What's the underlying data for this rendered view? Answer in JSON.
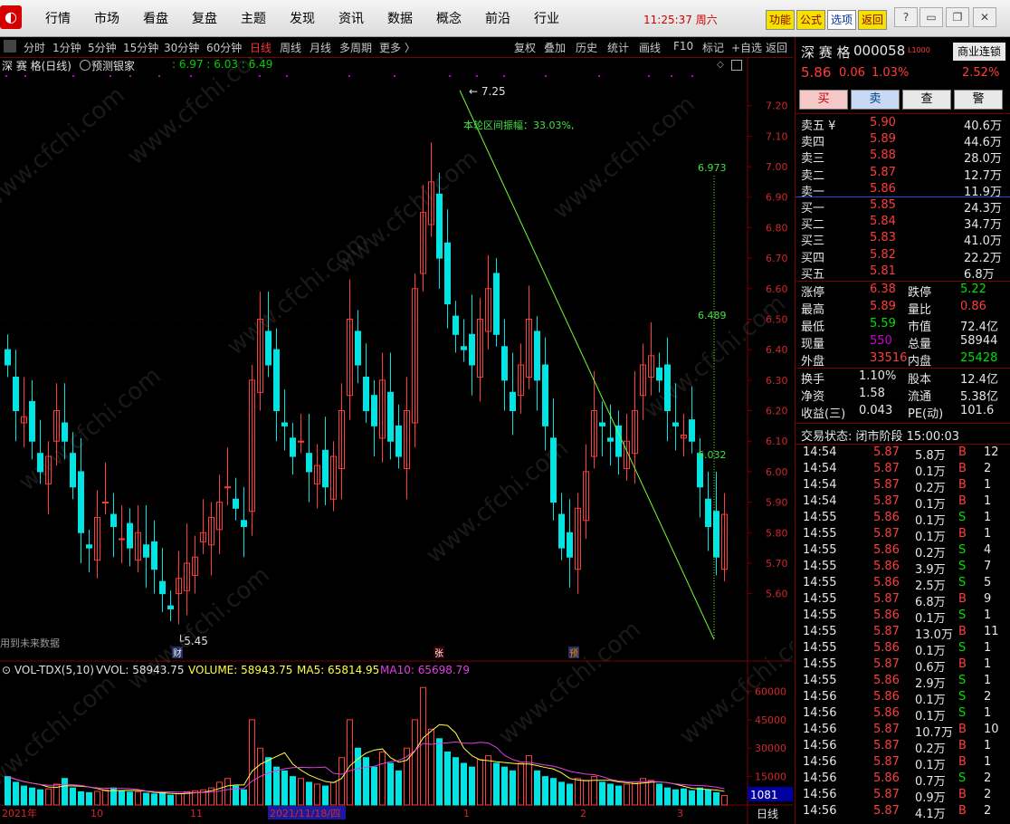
{
  "menu": {
    "items": [
      "行情",
      "市场",
      "看盘",
      "复盘",
      "主题",
      "发现",
      "资讯",
      "数据",
      "概念",
      "前沿",
      "行业"
    ],
    "clock": "11:25:37 周六",
    "fn_buttons": [
      "功能",
      "公式",
      "选项",
      "返回"
    ]
  },
  "toolbar": {
    "periods": [
      "分时",
      "1分钟",
      "5分钟",
      "15分钟",
      "30分钟",
      "60分钟",
      "日线",
      "周线",
      "月线",
      "多周期",
      "更多 〉"
    ],
    "active_period": "日线",
    "actions": [
      "复权",
      "叠加",
      "历史",
      "统计",
      "画线",
      "F10",
      "标记",
      "+自选",
      "返回"
    ]
  },
  "chart": {
    "title": "深 赛 格(日线)",
    "forecast_label": "预测银家",
    "ma_values": ": 6.97 : 6.03 : 6.49",
    "high_label": "7.25",
    "low_label": "5.45",
    "range_text": "本轮区间振幅：33.03%,",
    "fib_labels": [
      "6.973",
      "6.489",
      "6.032"
    ],
    "future_note": "用到未来数据",
    "event_markers": [
      "财",
      "张",
      "预"
    ],
    "price_ticks": [
      "7.20",
      "7.10",
      "7.00",
      "6.90",
      "6.80",
      "6.70",
      "6.60",
      "6.50",
      "6.40",
      "6.30",
      "6.20",
      "6.10",
      "6.00",
      "5.90",
      "5.80",
      "5.70",
      "5.60"
    ],
    "vol_header": {
      "name": "VOL-TDX(5,10)",
      "vvol": "VVOL: 58943.75",
      "volume": "VOLUME: 58943.75",
      "ma5": "MA5: 65814.95",
      "ma10": "MA10: 65698.79"
    },
    "vol_ticks": [
      "60000",
      "45000",
      "30000",
      "15000"
    ],
    "vol_current": "1081",
    "date_ticks": [
      "2021年",
      "10",
      "11",
      "2021/11/18/四",
      "1",
      "2",
      "3"
    ],
    "footer_tab": "日线",
    "watermark": "www.cfchi.com"
  },
  "chart_data": {
    "type": "candlestick",
    "ylim": [
      5.4,
      7.3
    ],
    "closes": [
      6.35,
      6.2,
      6.18,
      6.1,
      6.0,
      6.05,
      6.2,
      6.1,
      5.95,
      5.8,
      5.75,
      5.85,
      5.9,
      5.82,
      5.78,
      5.75,
      5.8,
      5.72,
      5.68,
      5.6,
      5.55,
      5.65,
      5.7,
      5.72,
      5.8,
      5.85,
      5.9,
      5.95,
      5.88,
      5.82,
      6.3,
      6.5,
      6.35,
      6.2,
      6.15,
      6.05,
      6.1,
      6.0,
      6.02,
      5.95,
      6.05,
      6.2,
      6.5,
      6.35,
      6.2,
      6.15,
      6.3,
      6.1,
      6.05,
      6.2,
      6.6,
      6.85,
      6.95,
      6.7,
      6.55,
      6.45,
      6.4,
      6.35,
      6.5,
      6.6,
      6.45,
      6.3,
      6.2,
      6.35,
      6.5,
      6.3,
      6.15,
      5.9,
      5.75,
      5.72,
      5.88,
      6.0,
      6.2,
      6.15,
      6.1,
      6.05,
      6.1,
      6.2,
      6.35,
      6.38,
      6.3,
      6.2,
      6.15,
      6.12,
      6.1,
      5.95,
      5.82,
      5.72,
      5.86
    ],
    "volumes": [
      15000,
      12000,
      10000,
      9000,
      8000,
      8500,
      11000,
      14000,
      9000,
      7000,
      6500,
      7200,
      8000,
      9000,
      7500,
      6800,
      7000,
      6200,
      5800,
      6500,
      5200,
      6000,
      7000,
      7500,
      8000,
      9000,
      12000,
      14000,
      10000,
      8000,
      45000,
      30000,
      25000,
      20000,
      18000,
      15000,
      14000,
      12000,
      11000,
      10000,
      12000,
      25000,
      45000,
      30000,
      25000,
      20000,
      28000,
      22000,
      18000,
      30000,
      45000,
      62000,
      40000,
      35000,
      28000,
      25000,
      22000,
      20000,
      24000,
      26000,
      22000,
      20000,
      18000,
      22000,
      26000,
      18000,
      15000,
      14000,
      12000,
      11000,
      14000,
      13000,
      15000,
      12000,
      11000,
      10000,
      11000,
      12000,
      14000,
      13000,
      11000,
      9000,
      8000,
      8500,
      7500,
      9000,
      8000,
      6500,
      5000
    ],
    "vol_ylim": [
      0,
      65000
    ]
  },
  "quote": {
    "name": "深 赛 格",
    "code": "000058",
    "tag": "L1000",
    "badge": "商业连锁",
    "price": "5.86",
    "change": "0.06",
    "pct": "1.03%",
    "amp": "2.52%",
    "actions": [
      "买",
      "卖",
      "查",
      "警"
    ],
    "asks": [
      [
        "卖五 ¥",
        "5.90",
        "40.6万"
      ],
      [
        "卖四",
        "5.89",
        "44.6万"
      ],
      [
        "卖三",
        "5.88",
        "28.0万"
      ],
      [
        "卖二",
        "5.87",
        "12.7万"
      ],
      [
        "卖一",
        "5.86",
        "11.9万"
      ]
    ],
    "bids": [
      [
        "买一",
        "5.85",
        "24.3万"
      ],
      [
        "买二",
        "5.84",
        "34.7万"
      ],
      [
        "买三",
        "5.83",
        "41.0万"
      ],
      [
        "买四",
        "5.82",
        "22.2万"
      ],
      [
        "买五",
        "5.81",
        "6.8万"
      ]
    ],
    "stats1": [
      [
        "涨停",
        "6.38",
        "跌停",
        "5.22"
      ],
      [
        "最高",
        "5.89",
        "量比",
        "0.86"
      ],
      [
        "最低",
        "5.59",
        "市值",
        "72.4亿"
      ],
      [
        "现量",
        "550",
        "总量",
        "58944"
      ],
      [
        "外盘",
        "33516",
        "内盘",
        "25428"
      ]
    ],
    "stats2": [
      [
        "换手",
        "1.10%",
        "股本",
        "12.4亿"
      ],
      [
        "净资",
        "1.58",
        "流通",
        "5.38亿"
      ],
      [
        "收益(三)",
        "0.043",
        "PE(动)",
        "101.6"
      ]
    ],
    "status": "交易状态: 闭市阶段 15:00:03",
    "trades": [
      [
        "14:54",
        "5.87",
        "5.8万",
        "B",
        "12"
      ],
      [
        "14:54",
        "5.87",
        "0.1万",
        "B",
        "2"
      ],
      [
        "14:54",
        "5.87",
        "0.2万",
        "B",
        "1"
      ],
      [
        "14:54",
        "5.87",
        "0.1万",
        "B",
        "1"
      ],
      [
        "14:55",
        "5.86",
        "0.1万",
        "S",
        "1"
      ],
      [
        "14:55",
        "5.87",
        "0.1万",
        "B",
        "1"
      ],
      [
        "14:55",
        "5.86",
        "0.2万",
        "S",
        "4"
      ],
      [
        "14:55",
        "5.86",
        "3.9万",
        "S",
        "7"
      ],
      [
        "14:55",
        "5.86",
        "2.5万",
        "S",
        "5"
      ],
      [
        "14:55",
        "5.87",
        "6.8万",
        "B",
        "9"
      ],
      [
        "14:55",
        "5.86",
        "0.1万",
        "S",
        "1"
      ],
      [
        "14:55",
        "5.87",
        "13.0万",
        "B",
        "11"
      ],
      [
        "14:55",
        "5.86",
        "0.1万",
        "S",
        "1"
      ],
      [
        "14:55",
        "5.87",
        "0.6万",
        "B",
        "1"
      ],
      [
        "14:55",
        "5.86",
        "2.9万",
        "S",
        "1"
      ],
      [
        "14:56",
        "5.86",
        "0.1万",
        "S",
        "2"
      ],
      [
        "14:56",
        "5.86",
        "0.1万",
        "S",
        "1"
      ],
      [
        "14:56",
        "5.87",
        "10.7万",
        "B",
        "10"
      ],
      [
        "14:56",
        "5.87",
        "0.2万",
        "B",
        "1"
      ],
      [
        "14:56",
        "5.87",
        "0.1万",
        "B",
        "1"
      ],
      [
        "14:56",
        "5.86",
        "0.7万",
        "S",
        "2"
      ],
      [
        "14:56",
        "5.87",
        "0.9万",
        "B",
        "2"
      ],
      [
        "14:56",
        "5.87",
        "4.1万",
        "B",
        "2"
      ]
    ]
  },
  "colors": {
    "up": "#ff3c3c",
    "down": "#00e4e4",
    "accent": "#d40000",
    "grid": "#7a0000"
  }
}
